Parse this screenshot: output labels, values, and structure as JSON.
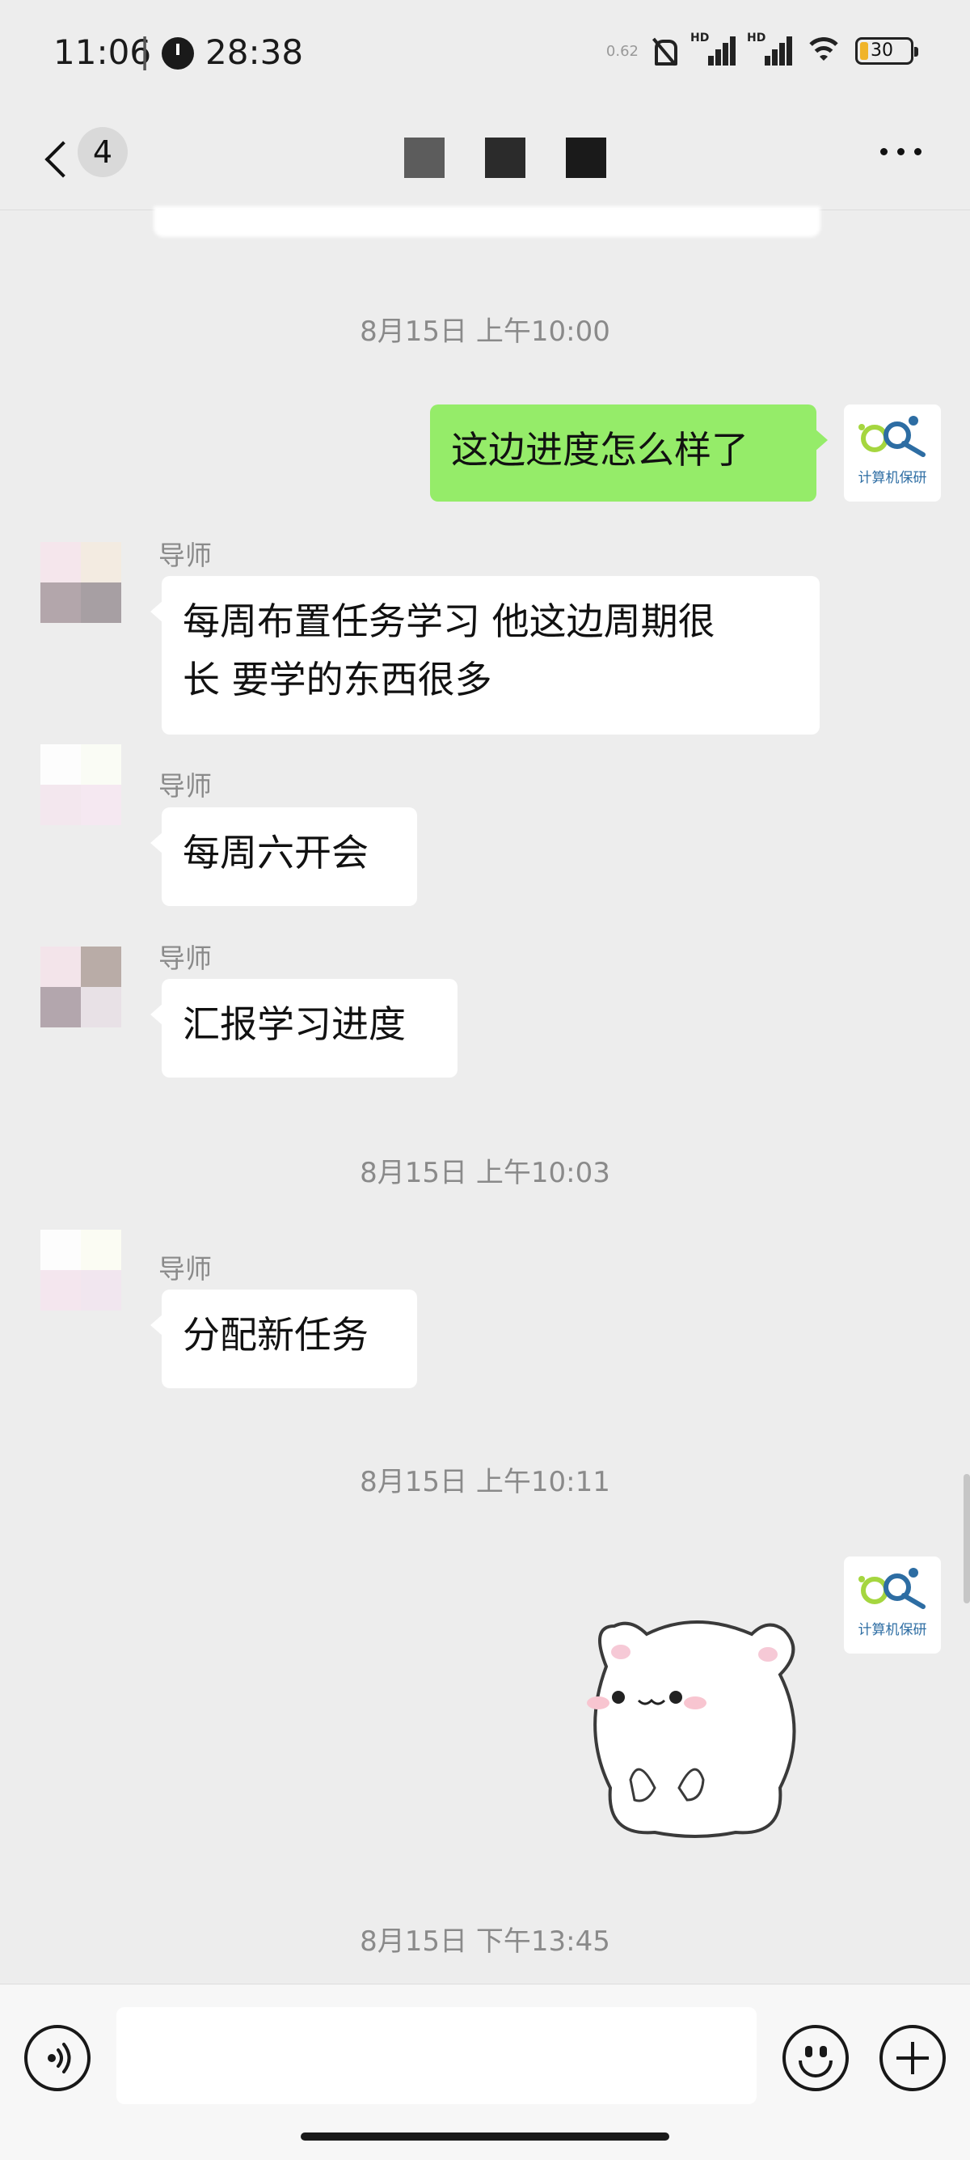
{
  "status_bar": {
    "time": "11:06",
    "separator": "|",
    "timer": "28:38",
    "network_speed": "0.62",
    "signal_1_label": "HD",
    "signal_2_label": "HD",
    "battery": "30",
    "icons": [
      "alarm-clock-icon",
      "mute-icon",
      "signal-icon",
      "wifi-icon",
      "battery-icon"
    ]
  },
  "header": {
    "back_count": "4",
    "more_icon": "more-icon"
  },
  "messages": [
    {
      "type": "timestamp",
      "text": "8月15日 上午10:00"
    },
    {
      "type": "outgoing",
      "text": "这边进度怎么样了",
      "avatar_caption": "计算机保研"
    },
    {
      "type": "incoming",
      "sender": "导师",
      "lines": [
        "每周布置任务学习 他这边周期很",
        "长 要学的东西很多"
      ]
    },
    {
      "type": "incoming",
      "sender": "导师",
      "text": "每周六开会"
    },
    {
      "type": "incoming",
      "sender": "导师",
      "text": "汇报学习进度"
    },
    {
      "type": "timestamp",
      "text": "8月15日 上午10:03"
    },
    {
      "type": "incoming",
      "sender": "导师",
      "text": "分配新任务"
    },
    {
      "type": "timestamp",
      "text": "8月15日 上午10:11"
    },
    {
      "type": "outgoing-sticker",
      "avatar_caption": "计算机保研",
      "sticker": "white-cat-sticker"
    },
    {
      "type": "timestamp",
      "text": "8月15日 下午13:45"
    }
  ],
  "colors": {
    "background": "#ededed",
    "outgoing_bubble": "#95ec69",
    "incoming_bubble": "#ffffff",
    "timestamp_text": "#8a8a8a",
    "logo_green": "#a5d63f",
    "logo_blue": "#2d6da3"
  },
  "input_bar": {
    "voice_icon": "voice-icon",
    "emoji_icon": "emoji-icon",
    "plus_icon": "plus-icon",
    "text_value": ""
  }
}
